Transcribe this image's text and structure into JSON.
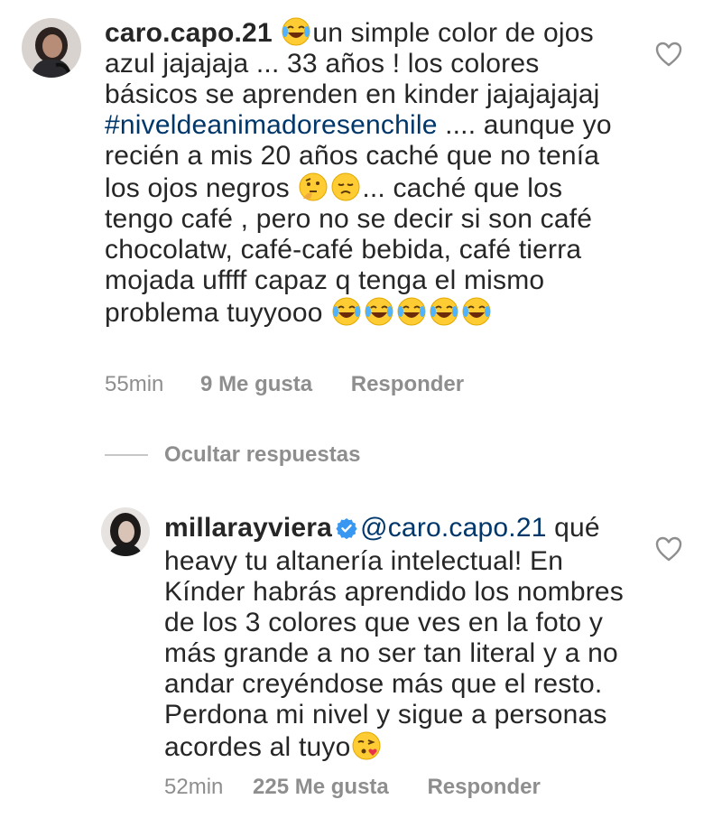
{
  "comments": [
    {
      "username": "caro.capo.21",
      "segments": [
        "un simple color de ojos azul jajajaja ... 33 años ! los colores básicos se aprenden en kinder jajajajajaj ",
        "#niveldeanimadoresenchile",
        " .... aunque yo recién a mis 20 años caché que no tenía los ojos negros ",
        "... caché que los tengo café , pero no se decir si son café chocolatw, café-café bebida, café tierra mojada uffff capaz q tenga el mismo problema tuyyooo "
      ],
      "time": "55min",
      "likes": "9 Me gusta",
      "reply_label": "Responder",
      "verified": false
    },
    {
      "username": "millarayviera",
      "mention": "@caro.capo.21",
      "text": " qué heavy tu altanería intelectual! En Kínder habrás aprendido los nombres de los 3 colores que ves en la foto y más grande a no ser tan literal y a no andar creyéndose más que el resto. Perdona mi nivel y sigue a personas acordes al tuyo",
      "time": "52min",
      "likes": "225 Me gusta",
      "reply_label": "Responder",
      "verified": true
    }
  ],
  "replies_toggle": {
    "label": "Ocultar respuestas"
  },
  "icons": {
    "like": "heart-outline-icon",
    "verified": "verified-badge-icon",
    "laughing": "face-with-tears-of-joy-emoji",
    "thinking": "thinking-face-emoji",
    "disappointed": "disappointed-face-emoji",
    "kiss": "face-blowing-a-kiss-emoji"
  },
  "colors": {
    "text": "#262626",
    "secondary": "#8e8e8e",
    "link": "#00376b",
    "verified": "#3897f0"
  }
}
